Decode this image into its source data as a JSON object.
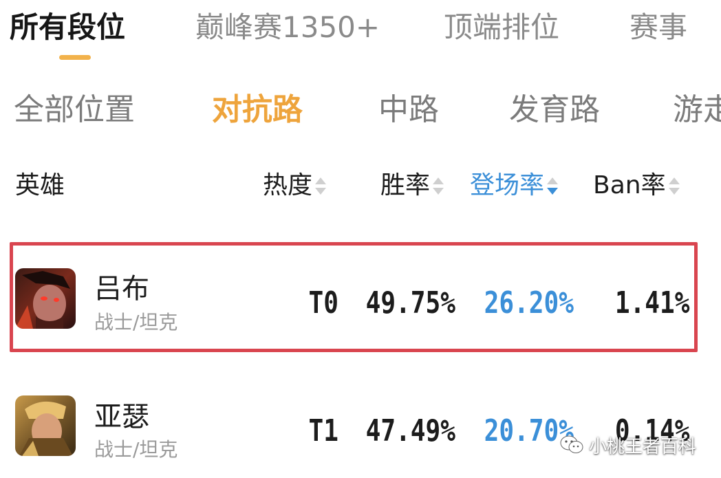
{
  "top_tabs": [
    {
      "label": "所有段位",
      "active": true
    },
    {
      "label": "巅峰赛1350+",
      "active": false
    },
    {
      "label": "顶端排位",
      "active": false
    },
    {
      "label": "赛事",
      "active": false
    }
  ],
  "position_tabs": [
    {
      "label": "全部位置",
      "active": false
    },
    {
      "label": "对抗路",
      "active": true
    },
    {
      "label": "中路",
      "active": false
    },
    {
      "label": "发育路",
      "active": false
    },
    {
      "label": "游走",
      "active": false
    }
  ],
  "table_header": {
    "hero": "英雄",
    "heat": "热度",
    "win_rate": "胜率",
    "pick_rate": "登场率",
    "ban_rate": "Ban率",
    "sorted_column": "pick_rate",
    "sort_direction": "desc"
  },
  "rows": [
    {
      "name": "吕布",
      "role": "战士/坦克",
      "tier": "T0",
      "win_rate": "49.75%",
      "pick_rate": "26.20%",
      "ban_rate": "1.41%",
      "avatar_icon": "hero-lubu-portrait",
      "highlighted": true
    },
    {
      "name": "亚瑟",
      "role": "战士/坦克",
      "tier": "T1",
      "win_rate": "47.49%",
      "pick_rate": "20.70%",
      "ban_rate": "0.14%",
      "avatar_icon": "hero-arthur-portrait",
      "highlighted": false
    }
  ],
  "watermark": {
    "text": "小桃王者百科",
    "icon": "wechat-icon"
  },
  "colors": {
    "active_tab_underline": "#f2b24b",
    "active_position": "#eea43c",
    "sort_active": "#3b8fd8",
    "highlight_border": "#d9454f"
  }
}
